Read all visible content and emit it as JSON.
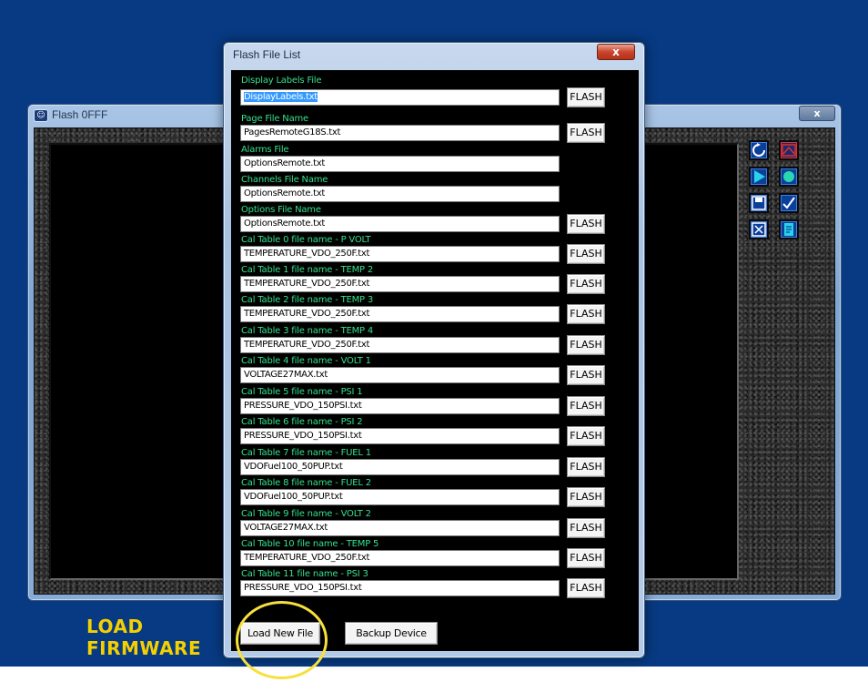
{
  "background_window": {
    "title": "Flash 0FFF",
    "close_glyph": "x",
    "icon_glyph": "☺",
    "toolbar_buttons": [
      {
        "icon": "refresh-icon"
      },
      {
        "icon": "chart-icon"
      },
      {
        "icon": "play-icon"
      },
      {
        "icon": "record-icon"
      },
      {
        "icon": "save-icon"
      },
      {
        "icon": "check-icon"
      },
      {
        "icon": "close-box-icon"
      },
      {
        "icon": "document-icon"
      }
    ]
  },
  "dialog": {
    "title": "Flash File List",
    "close_glyph": "x",
    "flash_label": "FLASH",
    "fields": [
      {
        "label": "Display Labels File",
        "value": "DisplayLabels.txt",
        "selected": true,
        "flash": true
      },
      {
        "label": "Page File Name",
        "value": "PagesRemoteG18S.txt",
        "flash": true
      },
      {
        "label": "Alarms File",
        "value": "OptionsRemote.txt",
        "flash": false
      },
      {
        "label": "Channels File Name",
        "value": "OptionsRemote.txt",
        "flash": false
      },
      {
        "label": "Options File Name",
        "value": "OptionsRemote.txt",
        "flash": true
      },
      {
        "label": "Cal Table 0 file name  - P VOLT",
        "value": "TEMPERATURE_VDO_250F.txt",
        "flash": true
      },
      {
        "label": "Cal Table 1 file name  - TEMP 2",
        "value": "TEMPERATURE_VDO_250F.txt",
        "flash": true
      },
      {
        "label": "Cal Table 2 file name  - TEMP 3",
        "value": "TEMPERATURE_VDO_250F.txt",
        "flash": true
      },
      {
        "label": "Cal Table 3 file name  - TEMP 4",
        "value": "TEMPERATURE_VDO_250F.txt",
        "flash": true
      },
      {
        "label": "Cal Table 4 file name  - VOLT 1",
        "value": "VOLTAGE27MAX.txt",
        "flash": true
      },
      {
        "label": "Cal Table 5 file name  - PSI 1",
        "value": "PRESSURE_VDO_150PSI.txt",
        "flash": true
      },
      {
        "label": "Cal Table 6 file name  - PSI 2",
        "value": "PRESSURE_VDO_150PSI.txt",
        "flash": true
      },
      {
        "label": "Cal Table 7 file name  - FUEL 1",
        "value": "VDOFuel100_50PUP.txt",
        "flash": true
      },
      {
        "label": "Cal Table 8 file name  - FUEL 2",
        "value": "VDOFuel100_50PUP.txt",
        "flash": true
      },
      {
        "label": "Cal Table 9 file name  - VOLT 2",
        "value": "VOLTAGE27MAX.txt",
        "flash": true
      },
      {
        "label": "Cal Table 10 file name  - TEMP 5",
        "value": "TEMPERATURE_VDO_250F.txt",
        "flash": true
      },
      {
        "label": "Cal Table 11 file name  - PSI 3",
        "value": "PRESSURE_VDO_150PSI.txt",
        "flash": true
      }
    ],
    "load_new_file_label": "Load New File",
    "backup_device_label": "Backup Device"
  },
  "annotation": {
    "line1": "LOAD",
    "line2": "FIRMWARE",
    "color": "#f5d000"
  },
  "colors": {
    "desktop": "#073a82",
    "label_green": "#35e08c",
    "selection": "#3399ff",
    "highlight_circle": "#f7e03c"
  }
}
